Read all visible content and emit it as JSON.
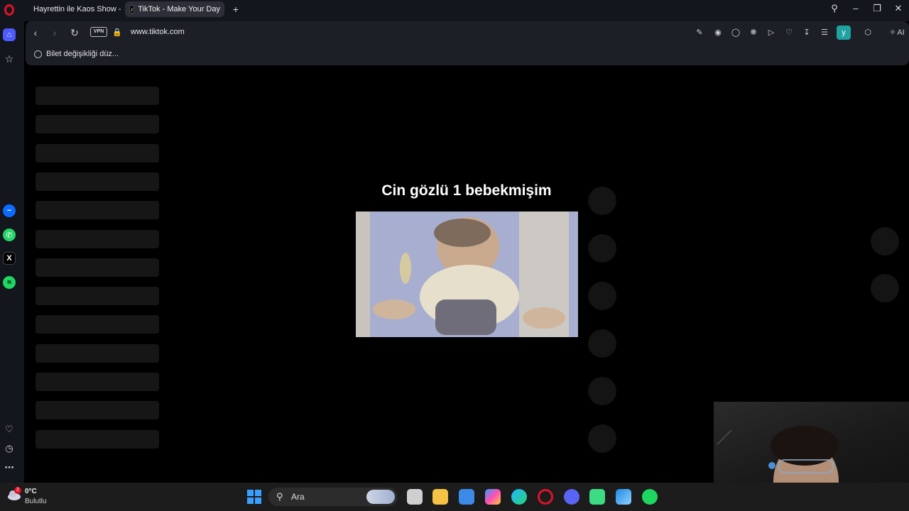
{
  "browser": {
    "tabs": [
      {
        "label": "Hayrettin ile Kaos Show -",
        "active": false
      },
      {
        "label": "TikTok - Make Your Day",
        "active": true
      }
    ],
    "new_tab_symbol": "+",
    "url": "www.tiktok.com",
    "vpn_label": "VPN",
    "ai_label": "AI",
    "profile_initial": "y",
    "bookmark_label": "Bilet değişikliği düz..."
  },
  "sidebar": {
    "icons": [
      "opera-logo-icon",
      "home-icon",
      "star-icon",
      "messenger-icon",
      "whatsapp-icon",
      "x-icon",
      "spotify-icon",
      "heart-icon",
      "history-icon",
      "more-icon"
    ]
  },
  "content": {
    "video_title": "Cin gözlü 1 bebekmişim",
    "skeleton_rows": 13
  },
  "taskbar": {
    "weather_temp": "0°C",
    "weather_desc": "Bulutlu",
    "notification_count": "2",
    "search_placeholder": "Ara",
    "apps": [
      "windows-start",
      "file-explorer",
      "microsoft-store",
      "copilot",
      "edge",
      "opera",
      "discord",
      "android-studio",
      "photos",
      "spotify"
    ]
  },
  "colors": {
    "accent_opera": "#e0112b",
    "home_active": "#4c5bff",
    "profile_bg": "#1fa3a0"
  }
}
